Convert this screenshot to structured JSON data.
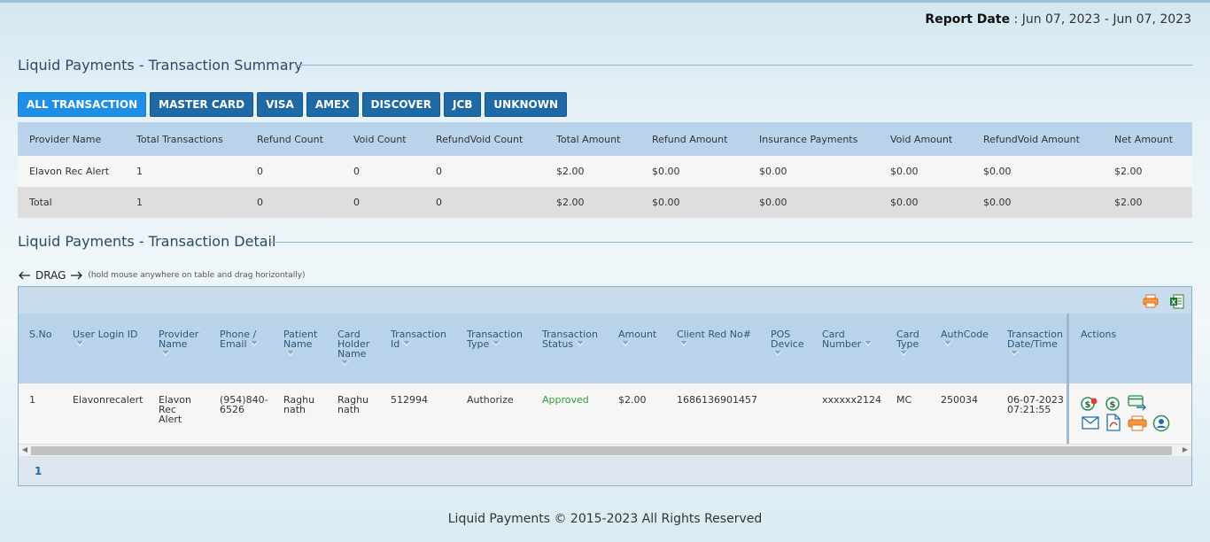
{
  "report": {
    "label": "Report Date",
    "value": ": Jun 07, 2023 - Jun 07, 2023"
  },
  "summary": {
    "title": "Liquid Payments - Transaction Summary",
    "filters": [
      "ALL TRANSACTION",
      "MASTER CARD",
      "VISA",
      "AMEX",
      "DISCOVER",
      "JCB",
      "UNKNOWN"
    ],
    "active_filter": "ALL TRANSACTION",
    "columns": [
      "Provider Name",
      "Total Transactions",
      "Refund Count",
      "Void Count",
      "RefundVoid Count",
      "Total Amount",
      "Refund Amount",
      "Insurance Payments",
      "Void Amount",
      "RefundVoid Amount",
      "Net Amount"
    ],
    "rows": [
      [
        "Elavon Rec Alert",
        "1",
        "0",
        "0",
        "0",
        "$2.00",
        "$0.00",
        "$0.00",
        "$0.00",
        "$0.00",
        "$2.00"
      ],
      [
        "Total",
        "1",
        "0",
        "0",
        "0",
        "$2.00",
        "$0.00",
        "$0.00",
        "$0.00",
        "$0.00",
        "$2.00"
      ]
    ]
  },
  "detail": {
    "title": "Liquid Payments - Transaction Detail",
    "drag_label": "DRAG",
    "drag_hint": "(hold mouse anywhere on table and drag horizontally)",
    "columns": [
      {
        "label": "S.No",
        "sortable": false
      },
      {
        "label": "User Login ID",
        "sortable": true
      },
      {
        "label": "Provider Name",
        "sortable": true
      },
      {
        "label": "Phone / Email",
        "sortable": true
      },
      {
        "label": "Patient Name",
        "sortable": true
      },
      {
        "label": "Card Holder Name",
        "sortable": true
      },
      {
        "label": "Transaction Id",
        "sortable": true
      },
      {
        "label": "Transaction Type",
        "sortable": true
      },
      {
        "label": "Transaction Status",
        "sortable": true
      },
      {
        "label": "Amount",
        "sortable": true
      },
      {
        "label": "Client Red No#",
        "sortable": true
      },
      {
        "label": "POS Device",
        "sortable": true
      },
      {
        "label": "Card Number",
        "sortable": true
      },
      {
        "label": "Card Type",
        "sortable": true
      },
      {
        "label": "AuthCode",
        "sortable": true
      },
      {
        "label": "Transaction Date/Time",
        "sortable": true
      },
      {
        "label": "Actions",
        "sortable": false
      }
    ],
    "rows": [
      {
        "sno": "1",
        "user_login_id": "Elavonrecalert",
        "provider_name": "Elavon Rec Alert",
        "phone_email": "(954)840-6526",
        "patient_name": "Raghu nath",
        "card_holder_name": "Raghu nath",
        "transaction_id": "512994",
        "transaction_type": "Authorize",
        "transaction_status": "Approved",
        "amount": "$2.00",
        "client_red_no": "1686136901457",
        "pos_device": "",
        "card_number": "xxxxxx2124",
        "card_type": "MC",
        "auth_code": "250034",
        "date_time": "06-07-2023 07:21:55",
        "actions": [
          "refund-icon",
          "capture-icon",
          "transfer-icon",
          "email-icon",
          "pdf-icon",
          "print-icon",
          "customer-icon"
        ]
      }
    ],
    "toolbar_icons": [
      "print-icon",
      "excel-icon"
    ],
    "pagination": {
      "current": "1"
    }
  },
  "footer": {
    "text": "Liquid Payments © 2015-2023 All Rights Reserved"
  },
  "colors": {
    "accent": "#1f6aa5",
    "active": "#1e8ee6",
    "header_bg": "#b9d4ea",
    "approved": "#2e9d3c"
  }
}
